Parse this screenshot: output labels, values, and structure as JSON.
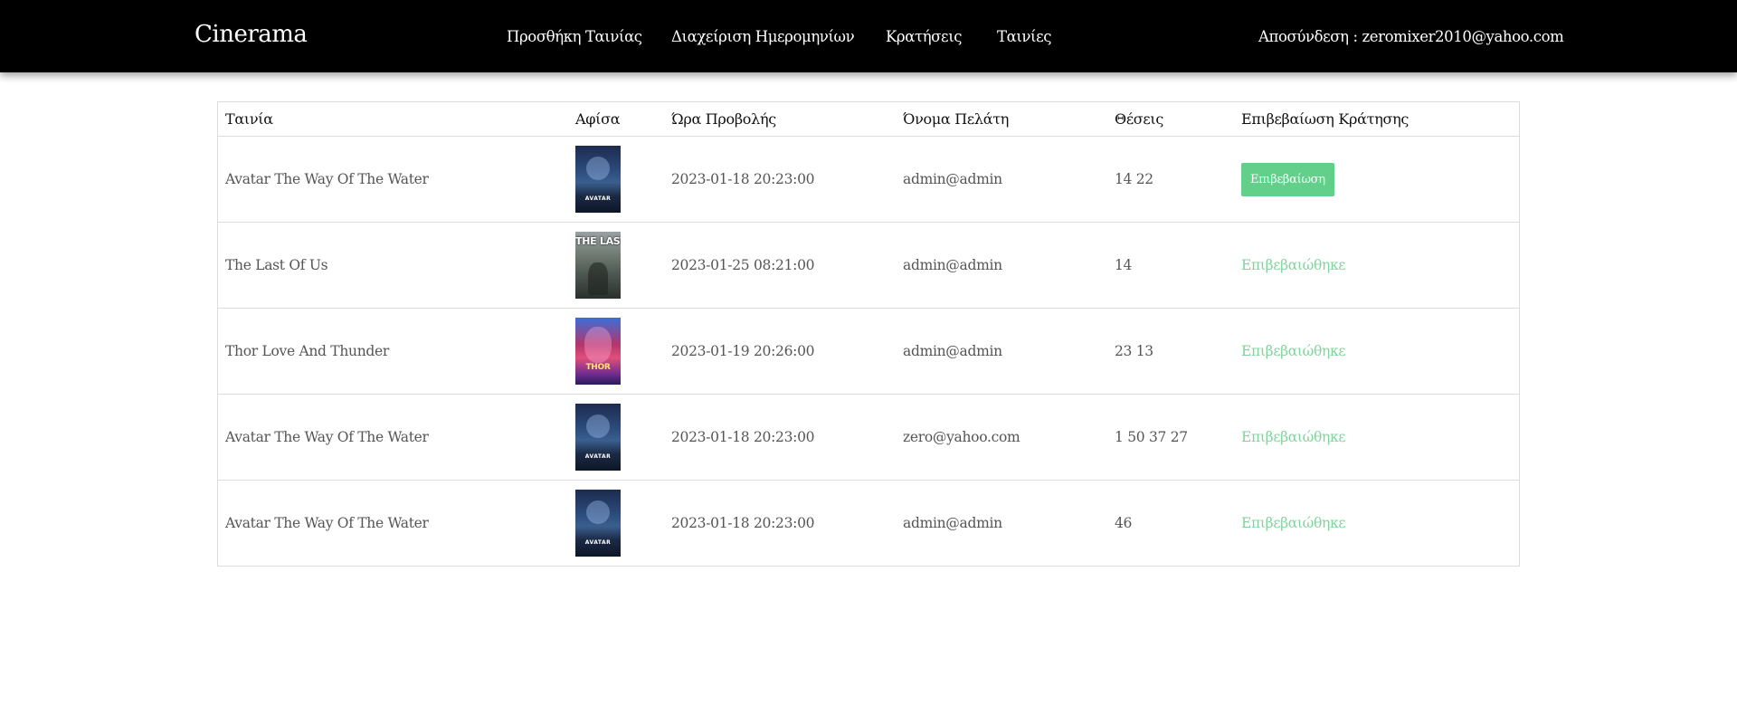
{
  "navbar": {
    "brand": "Cinerama",
    "links": {
      "add_movie": "Προσθήκη Ταινίας",
      "manage_dates": "Διαχείριση Ημερομηνίων",
      "bookings": "Κρατήσεις",
      "movies": "Ταινίες"
    },
    "logout": "Αποσύνδεση : zeromixer2010@yahoo.com"
  },
  "table": {
    "headers": {
      "movie": "Ταινία",
      "poster": "Αφίσα",
      "showtime": "Ώρα Προβολής",
      "customer": "Όνομα Πελάτη",
      "seats": "Θέσεις",
      "confirmation": "Επιβεβαίωση Κράτησης"
    },
    "rows": [
      {
        "movie": "Avatar The Way Of The Water",
        "poster": "avatar-poster",
        "poster_text": "AVATAR",
        "showtime": "2023-01-18 20:23:00",
        "customer": "admin@admin",
        "seats": "14 22",
        "status": "Επιβεβαίωση"
      },
      {
        "movie": "The Last Of Us",
        "poster": "the-last-of-us-poster",
        "poster_text": "THE LAST OF US",
        "showtime": "2023-01-25 08:21:00",
        "customer": "admin@admin",
        "seats": "14",
        "status": "Επιβεβαιώθηκε"
      },
      {
        "movie": "Thor Love And Thunder",
        "poster": "thor-poster",
        "poster_text": "THOR",
        "showtime": "2023-01-19 20:26:00",
        "customer": "admin@admin",
        "seats": "23 13",
        "status": "Επιβεβαιώθηκε"
      },
      {
        "movie": "Avatar The Way Of The Water",
        "poster": "avatar-poster",
        "poster_text": "AVATAR",
        "showtime": "2023-01-18 20:23:00",
        "customer": "zero@yahoo.com",
        "seats": "1 50 37 27",
        "status": "Επιβεβαιώθηκε"
      },
      {
        "movie": "Avatar The Way Of The Water",
        "poster": "avatar-poster",
        "poster_text": "AVATAR",
        "showtime": "2023-01-18 20:23:00",
        "customer": "admin@admin",
        "seats": "46",
        "status": "Επιβεβαιώθηκε"
      }
    ]
  },
  "colors": {
    "navbar_bg": "#000000",
    "confirm_button": "#62d08b",
    "confirmed_text": "#7fd49c"
  }
}
